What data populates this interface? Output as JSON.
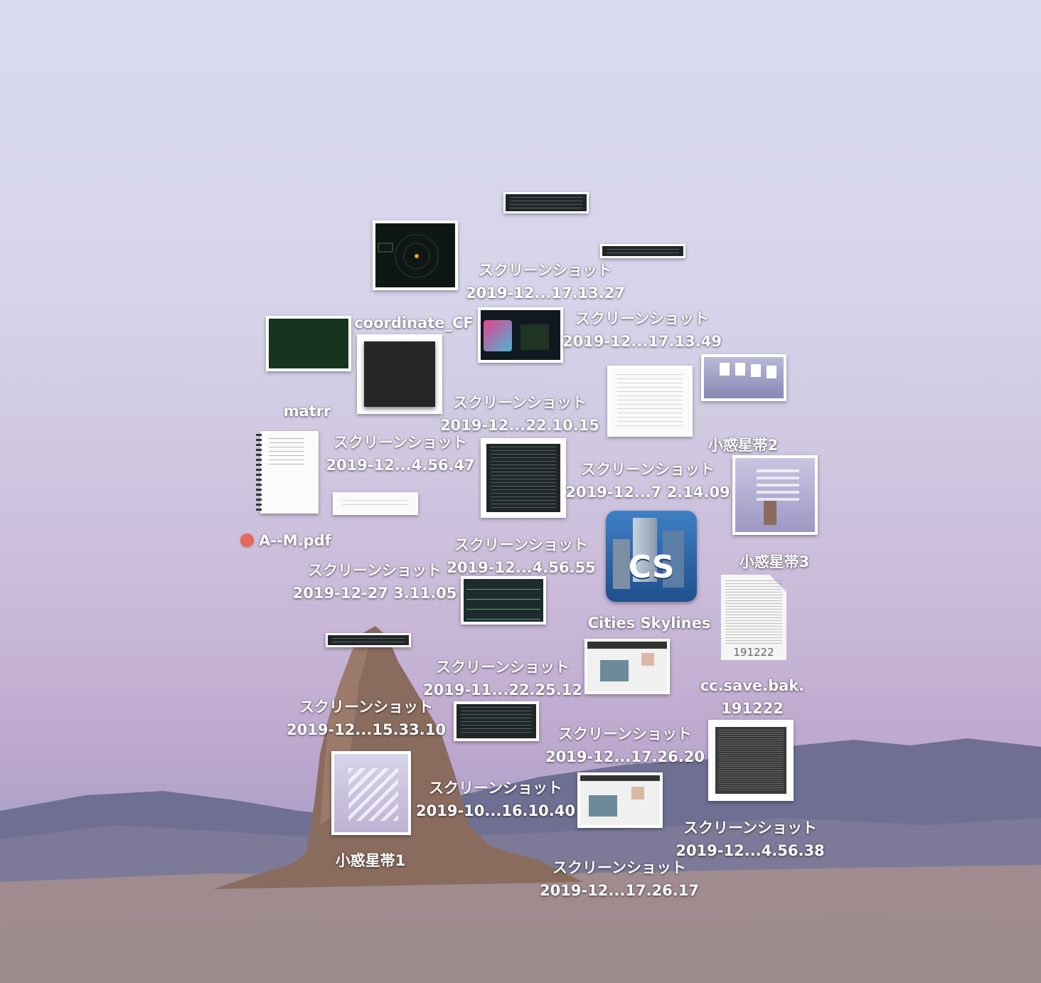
{
  "desktop": {
    "wallpaper_colors": {
      "sky_top": "#d9dbee",
      "sky_mid": "#cfc6e0",
      "rock": "#8a6d60",
      "mountains": "#6d6e8f",
      "ground": "#9c8883"
    },
    "files": [
      {
        "name": "スクリーンショット\n2019-12...17.13.27",
        "line1": "スクリーンショット",
        "line2": "2019-12...17.13.27"
      },
      {
        "name": "スクリーンショット\n2019-12...17.13.49",
        "line1": "スクリーンショット",
        "line2": "2019-12...17.13.49"
      },
      {
        "name": "coordinate_CF",
        "line1": "coordinate_CF"
      },
      {
        "name": "matrr",
        "line1": "matrr"
      },
      {
        "name": "スクリーンショット\n2019-12...22.10.15",
        "line1": "スクリーンショット",
        "line2": "2019-12...22.10.15"
      },
      {
        "name": "スクリーンショット\n2019-12...4.56.47",
        "line1": "スクリーンショット",
        "line2": "2019-12...4.56.47"
      },
      {
        "name": "小惑星帯2",
        "line1": "小惑星帯2"
      },
      {
        "name": "スクリーンショット\n2019-12...7 2.14.09",
        "line1": "スクリーンショット",
        "line2": "2019-12...7 2.14.09"
      },
      {
        "name": "A--M.pdf",
        "line1": "A--M.pdf",
        "tag_color": "#e8675c"
      },
      {
        "name": "スクリーンショット\n2019-12...4.56.55",
        "line1": "スクリーンショット",
        "line2": "2019-12...4.56.55"
      },
      {
        "name": "スクリーンショット\n2019-12-27 3.11.05",
        "line1": "スクリーンショット",
        "line2": "2019-12-27 3.11.05"
      },
      {
        "name": "小惑星帯3",
        "line1": "小惑星帯3"
      },
      {
        "name": "Cities Skylines",
        "line1": "Cities Skylines",
        "icon": "CS"
      },
      {
        "name": "191222",
        "line1": "191222"
      },
      {
        "name": "スクリーンショット\n2019-11...22.25.12",
        "line1": "スクリーンショット",
        "line2": "2019-11...22.25.12"
      },
      {
        "name": "cc.save.bak.\n191222",
        "line1": "cc.save.bak.",
        "line2": "191222"
      },
      {
        "name": "スクリーンショット\n2019-12...15.33.10",
        "line1": "スクリーンショット",
        "line2": "2019-12...15.33.10"
      },
      {
        "name": "スクリーンショット\n2019-12...17.26.20",
        "line1": "スクリーンショット",
        "line2": "2019-12...17.26.20"
      },
      {
        "name": "スクリーンショット\n2019-10...16.10.40",
        "line1": "スクリーンショット",
        "line2": "2019-10...16.10.40"
      },
      {
        "name": "小惑星帯1",
        "line1": "小惑星帯1"
      },
      {
        "name": "スクリーンショット\n2019-12...4.56.38",
        "line1": "スクリーンショット",
        "line2": "2019-12...4.56.38"
      },
      {
        "name": "スクリーンショット\n2019-12...17.26.17",
        "line1": "スクリーンショット",
        "line2": "2019-12...17.26.17"
      }
    ]
  }
}
